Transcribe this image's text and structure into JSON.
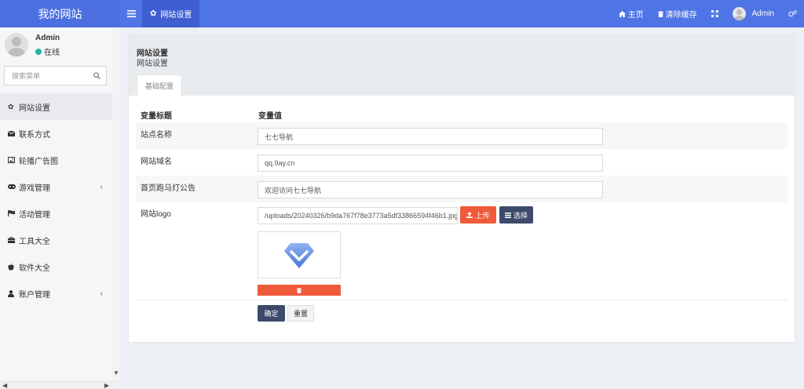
{
  "brand": {
    "title": "我的网站"
  },
  "topnav": {
    "menu_icon": "bars-icon",
    "active_tab": {
      "icon": "gear-icon",
      "label": "网站设置"
    },
    "home_label": "主页",
    "clear_cache_label": "清除缓存",
    "user_name": "Admin"
  },
  "sidebar": {
    "user": {
      "name": "Admin",
      "status": "在线"
    },
    "search": {
      "placeholder": "搜索菜单"
    },
    "items": [
      {
        "label": "网站设置",
        "icon": "gear-icon",
        "active": true
      },
      {
        "label": "联系方式",
        "icon": "envelope-icon"
      },
      {
        "label": "轮播广告图",
        "icon": "image-icon"
      },
      {
        "label": "游戏管理",
        "icon": "gamepad-icon",
        "expandable": true
      },
      {
        "label": "活动管理",
        "icon": "flag-icon"
      },
      {
        "label": "工具大全",
        "icon": "briefcase-icon"
      },
      {
        "label": "软件大全",
        "icon": "apple-icon"
      },
      {
        "label": "账户管理",
        "icon": "user-icon",
        "expandable": true
      }
    ]
  },
  "page": {
    "title": "网站设置",
    "subtitle": "网站设置",
    "tab": "基础配置"
  },
  "table": {
    "header": {
      "key": "变量标题",
      "value": "变量值"
    },
    "rows": [
      {
        "label": "站点名称",
        "value": "七七导航"
      },
      {
        "label": "网站域名",
        "value": "qq.9ay.cn"
      },
      {
        "label": "首页跑马灯公告",
        "value": "欢迎访问七七导航"
      },
      {
        "label": "网站logo",
        "value": "/uploads/20240326/b9da767f78e3773a5df33866594f46b1.jpg"
      }
    ]
  },
  "buttons": {
    "upload": "上传",
    "choose": "选择",
    "confirm": "确定",
    "reset": "重置"
  },
  "colors": {
    "accent": "#4f74e6",
    "danger": "#f05a3c",
    "dark": "#3d4a6b",
    "online": "#1fb5a0"
  }
}
